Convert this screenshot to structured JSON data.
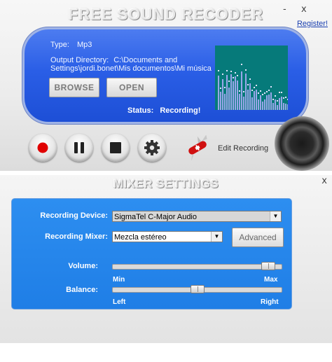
{
  "app": {
    "title": "FREE SOUND RECODER",
    "window_controls": {
      "minimize": "-",
      "close": "x"
    },
    "register_link": "Register!"
  },
  "info": {
    "type_label": "Type:",
    "type_value": "Mp3",
    "output_label": "Output Directory:",
    "output_line1": "C:\\Documents and",
    "output_line2": "Settings\\jordi.bonet\\Mis documentos\\Mi música"
  },
  "buttons": {
    "browse": "BROWSE",
    "open": "OPEN"
  },
  "status": {
    "label": "Status:",
    "value": "Recording!"
  },
  "controls": {
    "edit_recording": "Edit Recording"
  },
  "colors": {
    "panel": "#2a5ee6",
    "mixer_panel": "#1f7ee6",
    "spectrum_bg": "#067a7a",
    "record_red": "#e00000"
  },
  "mixer": {
    "title": "MIXER SETTINGS",
    "close": "x",
    "recording_device_label": "Recording Device:",
    "recording_device_value": "SigmaTel C-Major Audio",
    "recording_mixer_label": "Recording Mixer:",
    "recording_mixer_value": "Mezcla estéreo",
    "advanced_button": "Advanced",
    "volume_label": "Volume:",
    "volume_min": "Min",
    "volume_max": "Max",
    "volume_level": 0.96,
    "balance_label": "Balance:",
    "balance_left": "Left",
    "balance_right": "Right",
    "balance_level": 0.5
  }
}
